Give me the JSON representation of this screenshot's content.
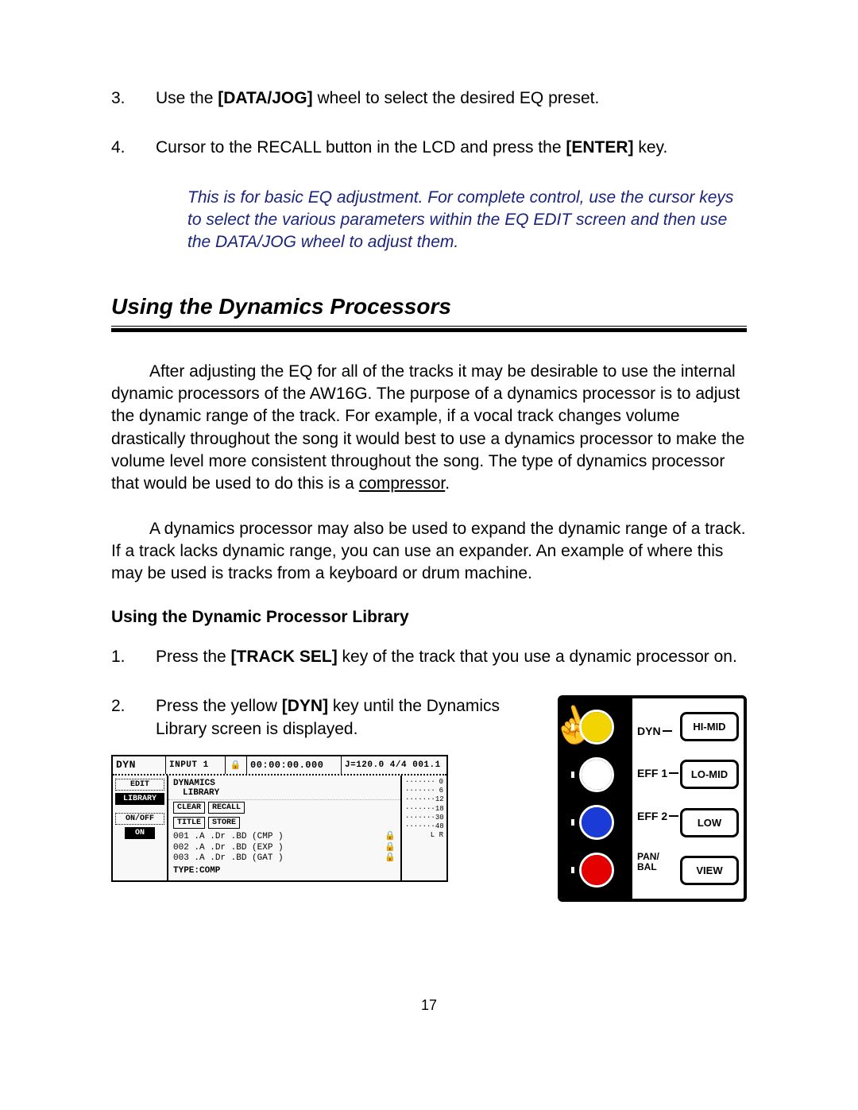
{
  "steps_top": [
    {
      "n": "3.",
      "html": "Use the <b>[DATA/JOG]</b> wheel to select the desired EQ preset."
    },
    {
      "n": "4.",
      "html": "Cursor to the RECALL button in the LCD and press the <b>[ENTER]</b> key."
    }
  ],
  "note": "This is for basic EQ adjustment.  For complete control, use the cursor keys to select the various parameters within the EQ EDIT screen and then use the DATA/JOG wheel to adjust them.",
  "section_title": "Using the Dynamics Processors",
  "para1_main": "After adjusting the EQ for all of the tracks it may be desirable to use the internal dynamic processors of the AW16G.  The purpose of a dynamics processor is to adjust the dynamic range of the track.  For example, if a vocal track changes volume drastically throughout the song it would best to use a dynamics processor to make the volume level more consistent throughout the song.  The type of dynamics processor that would be used to do this is a ",
  "para1_u": "compressor",
  "para2": "A dynamics processor may also be used to expand the dynamic range of a track.  If a track lacks dynamic range, you can use an expander. An example of where this may be used is tracks from a keyboard or drum machine.",
  "subhead": "Using the Dynamic Processor Library",
  "steps_lib": [
    {
      "n": "1.",
      "html": "Press the <b>[TRACK SEL]</b> key of the track that you use a dynamic processor on."
    },
    {
      "n": "2.",
      "html": "Press the yellow <b>[DYN]</b> key until the Dynamics Library screen is displayed."
    }
  ],
  "lcd": {
    "title": "DYN",
    "input": "INPUT  1",
    "lock": "🔒",
    "time": "00:00:00.000",
    "tempo": "J=120.0 4/4 001.1",
    "side": {
      "edit": "EDIT",
      "library": "LIBRARY",
      "onoff": "ON/OFF",
      "on": "ON"
    },
    "heading1": "DYNAMICS",
    "heading2": "LIBRARY",
    "btn_clear": "CLEAR",
    "btn_recall": "RECALL",
    "btn_title": "TITLE",
    "btn_store": "STORE",
    "type": "TYPE:COMP",
    "list": [
      {
        "id": "001",
        "name": ".A .Dr .BD (CMP )",
        "lock": "🔒"
      },
      {
        "id": "002",
        "name": ".A .Dr .BD (EXP )",
        "lock": "🔒"
      },
      {
        "id": "003",
        "name": ".A .Dr .BD (GAT )",
        "lock": "🔒"
      }
    ],
    "meter_labels": [
      "0",
      "6",
      "12",
      "18",
      "30",
      "48",
      "L R"
    ]
  },
  "panel": {
    "knobs": [
      {
        "color": "#f2d400",
        "label": "DYN"
      },
      {
        "color": "#ffffff",
        "label": "EFF 1"
      },
      {
        "color": "#1a3bd6",
        "label": "EFF 2"
      },
      {
        "color": "#e40000",
        "label": "PAN/\nBAL"
      }
    ],
    "buttons": [
      "HI-MID",
      "LO-MID",
      "LOW",
      "VIEW"
    ]
  },
  "page_number": "17"
}
